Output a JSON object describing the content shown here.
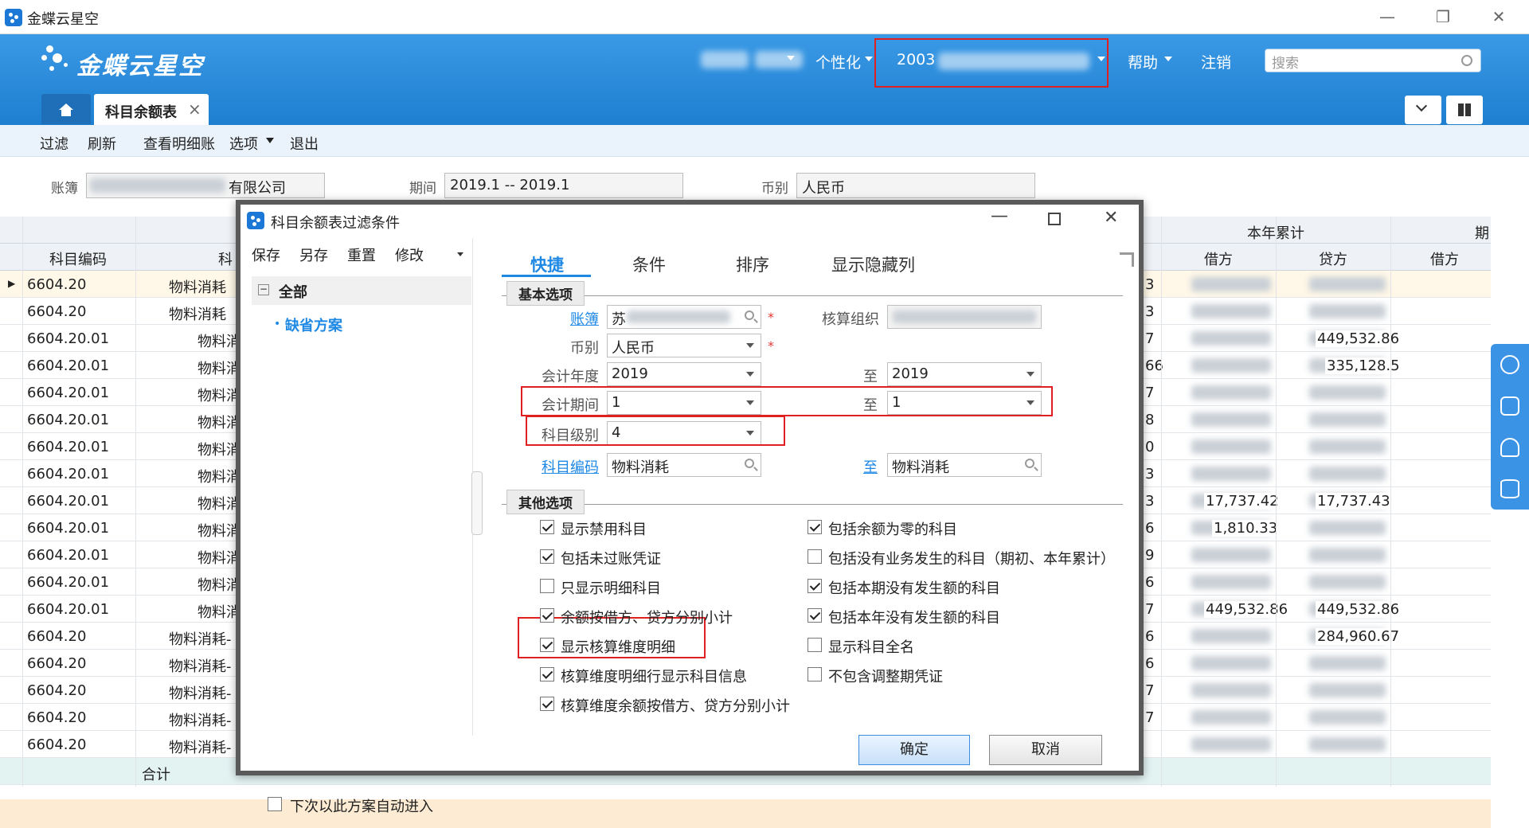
{
  "window": {
    "title": "金蝶云星空",
    "min": "—",
    "max": "❐",
    "close": "✕"
  },
  "header": {
    "logo": "金蝶云星空",
    "nav": {
      "personalize": "个性化",
      "org": "2003",
      "help": "帮助",
      "logout": "注销"
    },
    "search_placeholder": "搜索"
  },
  "tabs": {
    "home_icon": "home-icon",
    "active_tab": "科目余额表",
    "close": "×"
  },
  "toolbar": [
    "过滤",
    "刷新",
    "查看明细账",
    "选项",
    "退出"
  ],
  "filters": {
    "book_label": "账簿",
    "book_value": "有限公司",
    "period_label": "期间",
    "period_value": "2019.1 -- 2019.1",
    "currency_label": "币别",
    "currency_value": "人民币"
  },
  "grid": {
    "header_code": "科目编码",
    "header_name": "科",
    "header_ytd": "本年累计",
    "header_debit": "借方",
    "header_credit": "贷方",
    "header_period": "期",
    "header_debit2": "借方",
    "rows": [
      {
        "code": "6604.20",
        "name": "物料消耗"
      },
      {
        "code": "6604.20",
        "name": "物料消耗"
      },
      {
        "code": "6604.20.01",
        "name": "物料消"
      },
      {
        "code": "6604.20.01",
        "name": "物料消"
      },
      {
        "code": "6604.20.01",
        "name": "物料消"
      },
      {
        "code": "6604.20.01",
        "name": "物料消"
      },
      {
        "code": "6604.20.01",
        "name": "物料消"
      },
      {
        "code": "6604.20.01",
        "name": "物料消"
      },
      {
        "code": "6604.20.01",
        "name": "物料消"
      },
      {
        "code": "6604.20.01",
        "name": "物料消"
      },
      {
        "code": "6604.20.01",
        "name": "物料消"
      },
      {
        "code": "6604.20.01",
        "name": "物料消"
      },
      {
        "code": "6604.20.01",
        "name": "物料消"
      },
      {
        "code": "6604.20",
        "name": "物料消耗-"
      },
      {
        "code": "6604.20",
        "name": "物料消耗-"
      },
      {
        "code": "6604.20",
        "name": "物料消耗-"
      },
      {
        "code": "6604.20",
        "name": "物料消耗-"
      },
      {
        "code": "6604.20",
        "name": "物料消耗-"
      }
    ],
    "total_label": "合计",
    "visible_nums": [
      "3",
      "3",
      "7",
      "66",
      "7",
      "8",
      "0",
      "3",
      "3",
      "6",
      "9",
      "6",
      "7",
      "6",
      "6",
      "7",
      "7"
    ],
    "debit_vals": [
      "1,810.33",
      "17,737.42",
      "449,532.86"
    ],
    "credit_vals": [
      "17,737.43",
      "335,128.5",
      "449,532.86",
      "284,960.67",
      "449,532.86"
    ]
  },
  "dialog": {
    "title": "科目余额表过滤条件",
    "left_actions": [
      "保存",
      "另存",
      "重置",
      "修改"
    ],
    "tree_root": "全部",
    "tree_child": "缺省方案",
    "auto_enter": "下次以此方案自动进入",
    "tabs": [
      "快捷",
      "条件",
      "排序",
      "显示隐藏列"
    ],
    "section_basic": "基本选项",
    "section_other": "其他选项",
    "fields": {
      "book_label": "账簿",
      "book_value": "苏",
      "org_label": "核算组织",
      "currency_label": "币别",
      "currency_value": "人民币",
      "year_label": "会计年度",
      "year_from": "2019",
      "year_to_label": "至",
      "year_to": "2019",
      "period_label": "会计期间",
      "period_from": "1",
      "period_to_label": "至",
      "period_to": "1",
      "level_label": "科目级别",
      "level_value": "4",
      "code_label": "科目编码",
      "code_from": "物料消耗",
      "code_to_label": "至",
      "code_to": "物料消耗"
    },
    "options_left": [
      {
        "label": "显示禁用科目",
        "checked": true
      },
      {
        "label": "包括未过账凭证",
        "checked": true
      },
      {
        "label": "只显示明细科目",
        "checked": false
      },
      {
        "label": "余额按借方、贷方分别小计",
        "checked": true
      },
      {
        "label": "显示核算维度明细",
        "checked": true
      },
      {
        "label": "核算维度明细行显示科目信息",
        "checked": true
      },
      {
        "label": "核算维度余额按借方、贷方分别小计",
        "checked": true
      }
    ],
    "options_right": [
      {
        "label": "包括余额为零的科目",
        "checked": true
      },
      {
        "label": "包括没有业务发生的科目（期初、本年累计）",
        "checked": false
      },
      {
        "label": "包括本期没有发生额的科目",
        "checked": true
      },
      {
        "label": "包括本年没有发生额的科目",
        "checked": true
      },
      {
        "label": "显示科目全名",
        "checked": false
      },
      {
        "label": "不包含调整期凭证",
        "checked": false
      }
    ],
    "ok": "确定",
    "cancel": "取消"
  },
  "colors": {
    "header_blue": "#2b8ad9",
    "highlight_red": "#e02020",
    "link_blue": "#1e88e5",
    "total_row": "#e3f3f2"
  }
}
